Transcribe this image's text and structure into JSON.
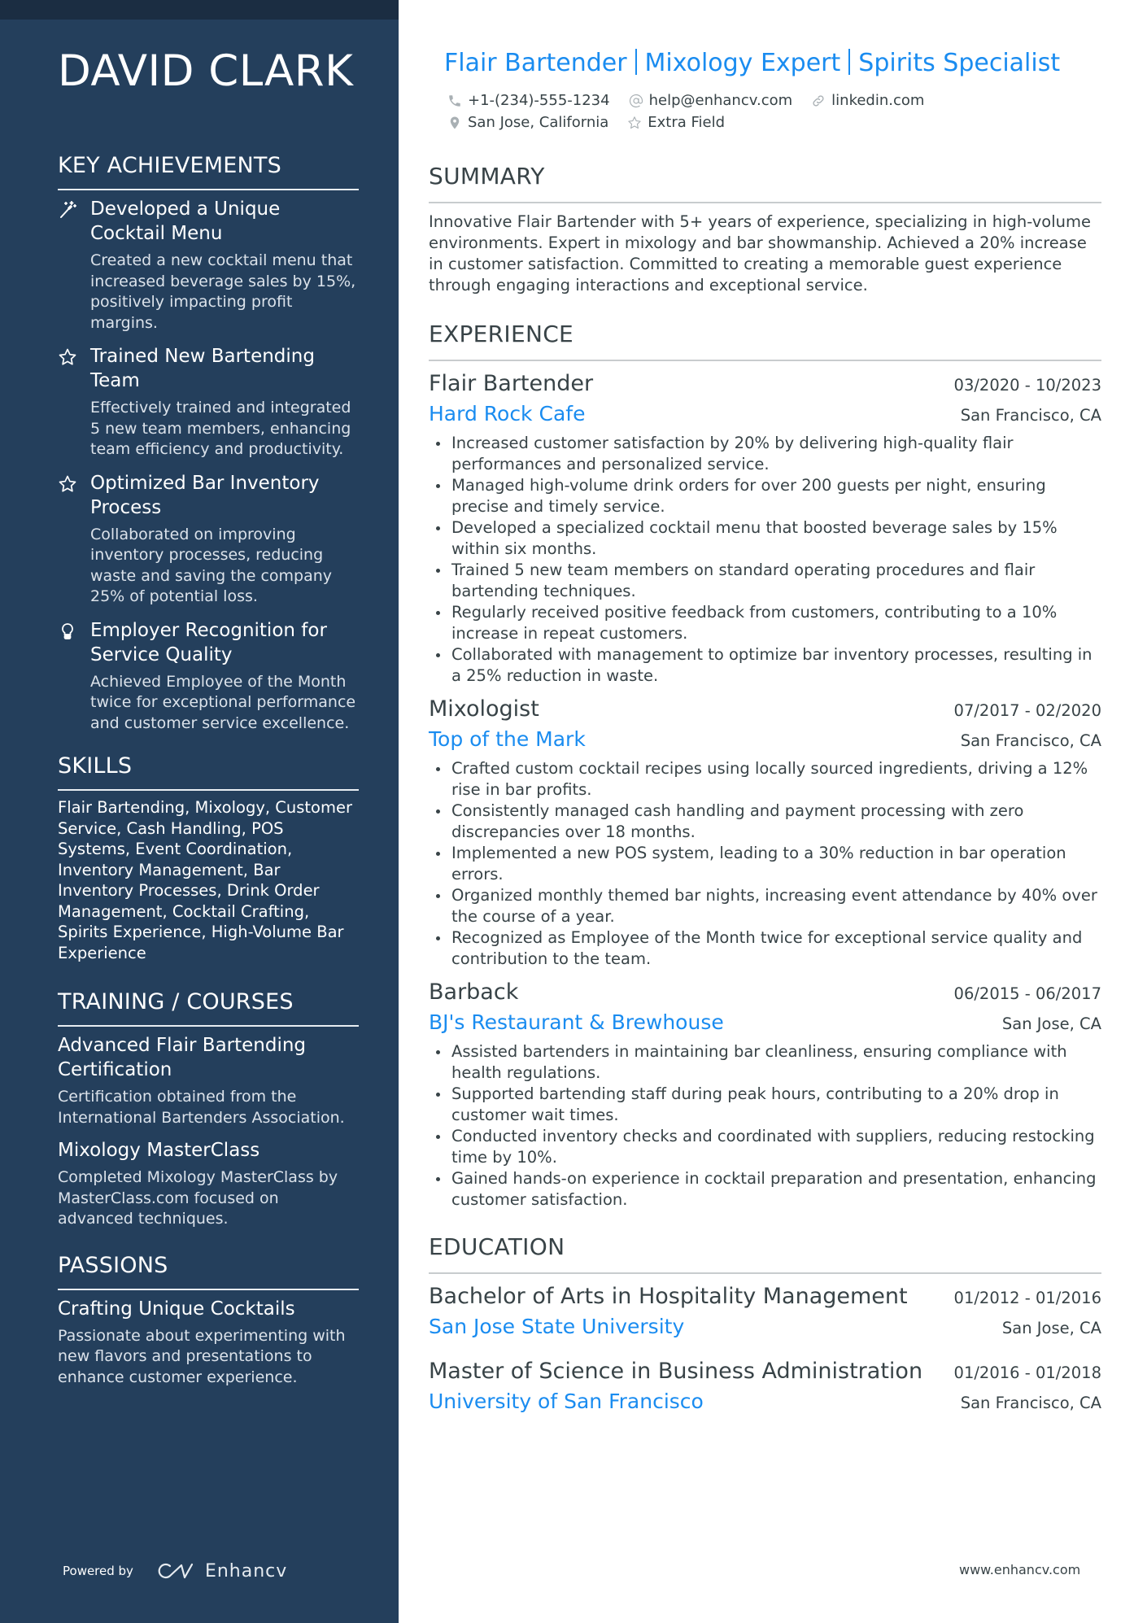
{
  "profile": {
    "name": "DAVID CLARK",
    "headline_parts": [
      "Flair Bartender",
      "Mixology Expert",
      "Spirits Specialist"
    ],
    "contacts": {
      "phone": "+1-(234)-555-1234",
      "email": "help@enhancv.com",
      "link": "linkedin.com",
      "location": "San Jose, California",
      "extra": "Extra Field"
    }
  },
  "sidebar": {
    "achievements": {
      "title": "KEY ACHIEVEMENTS",
      "items": [
        {
          "icon": "magic-wand-icon",
          "title": "Developed a Unique Cocktail Menu",
          "desc": "Created a new cocktail menu that increased beverage sales by 15%, positively impacting profit margins."
        },
        {
          "icon": "star-icon",
          "title": "Trained New Bartending Team",
          "desc": "Effectively trained and integrated 5 new team members, enhancing team efficiency and productivity."
        },
        {
          "icon": "star-icon",
          "title": "Optimized Bar Inventory Process",
          "desc": "Collaborated on improving inventory processes, reducing waste and saving the company 25% of potential loss."
        },
        {
          "icon": "lightbulb-icon",
          "title": "Employer Recognition for Service Quality",
          "desc": "Achieved Employee of the Month twice for exceptional performance and customer service excellence."
        }
      ]
    },
    "skills": {
      "title": "SKILLS",
      "text": "Flair Bartending, Mixology, Customer Service, Cash Handling, POS Systems, Event Coordination, Inventory Management, Bar Inventory Processes, Drink Order Management, Cocktail Crafting, Spirits Experience, High-Volume Bar Experience"
    },
    "training": {
      "title": "TRAINING / COURSES",
      "items": [
        {
          "title": "Advanced Flair Bartending Certification",
          "desc": "Certification obtained from the International Bartenders Association."
        },
        {
          "title": "Mixology MasterClass",
          "desc": "Completed Mixology MasterClass by MasterClass.com focused on advanced techniques."
        }
      ]
    },
    "passions": {
      "title": "PASSIONS",
      "items": [
        {
          "title": "Crafting Unique Cocktails",
          "desc": "Passionate about experimenting with new flavors and presentations to enhance customer experience."
        }
      ]
    },
    "powered_by": "Powered by",
    "brand": "Enhancv"
  },
  "main": {
    "summary": {
      "title": "SUMMARY",
      "text": "Innovative Flair Bartender with 5+ years of experience, specializing in high-volume environments. Expert in mixology and bar showmanship. Achieved a 20% increase in customer satisfaction. Committed to creating a memorable guest experience through engaging interactions and exceptional service."
    },
    "experience": {
      "title": "EXPERIENCE",
      "jobs": [
        {
          "title": "Flair Bartender",
          "dates": "03/2020 - 10/2023",
          "company": "Hard Rock Cafe",
          "location": "San Francisco, CA",
          "bullets": [
            "Increased customer satisfaction by 20% by delivering high-quality flair performances and personalized service.",
            "Managed high-volume drink orders for over 200 guests per night, ensuring precise and timely service.",
            "Developed a specialized cocktail menu that boosted beverage sales by 15% within six months.",
            "Trained 5 new team members on standard operating procedures and flair bartending techniques.",
            "Regularly received positive feedback from customers, contributing to a 10% increase in repeat customers.",
            "Collaborated with management to optimize bar inventory processes, resulting in a 25% reduction in waste."
          ]
        },
        {
          "title": "Mixologist",
          "dates": "07/2017 - 02/2020",
          "company": "Top of the Mark",
          "location": "San Francisco, CA",
          "bullets": [
            "Crafted custom cocktail recipes using locally sourced ingredients, driving a 12% rise in bar profits.",
            "Consistently managed cash handling and payment processing with zero discrepancies over 18 months.",
            "Implemented a new POS system, leading to a 30% reduction in bar operation errors.",
            "Organized monthly themed bar nights, increasing event attendance by 40% over the course of a year.",
            "Recognized as Employee of the Month twice for exceptional service quality and contribution to the team."
          ]
        },
        {
          "title": "Barback",
          "dates": "06/2015 - 06/2017",
          "company": "BJ's Restaurant & Brewhouse",
          "location": "San Jose, CA",
          "bullets": [
            "Assisted bartenders in maintaining bar cleanliness, ensuring compliance with health regulations.",
            "Supported bartending staff during peak hours, contributing to a 20% drop in customer wait times.",
            "Conducted inventory checks and coordinated with suppliers, reducing restocking time by 10%.",
            "Gained hands-on experience in cocktail preparation and presentation, enhancing customer satisfaction."
          ]
        }
      ]
    },
    "education": {
      "title": "EDUCATION",
      "items": [
        {
          "degree": "Bachelor of Arts in Hospitality Management",
          "dates": "01/2012 - 01/2016",
          "school": "San Jose State University",
          "location": "San Jose, CA"
        },
        {
          "degree": "Master of Science in Business Administration",
          "dates": "01/2016 - 01/2018",
          "school": "University of San Francisco",
          "location": "San Francisco, CA"
        }
      ]
    }
  },
  "footer": {
    "url": "www.enhancv.com"
  },
  "colors": {
    "sidebar_bg": "#243f5c",
    "sidebar_top": "#1b2d42",
    "accent": "#1a8cf0",
    "text": "#384347"
  }
}
